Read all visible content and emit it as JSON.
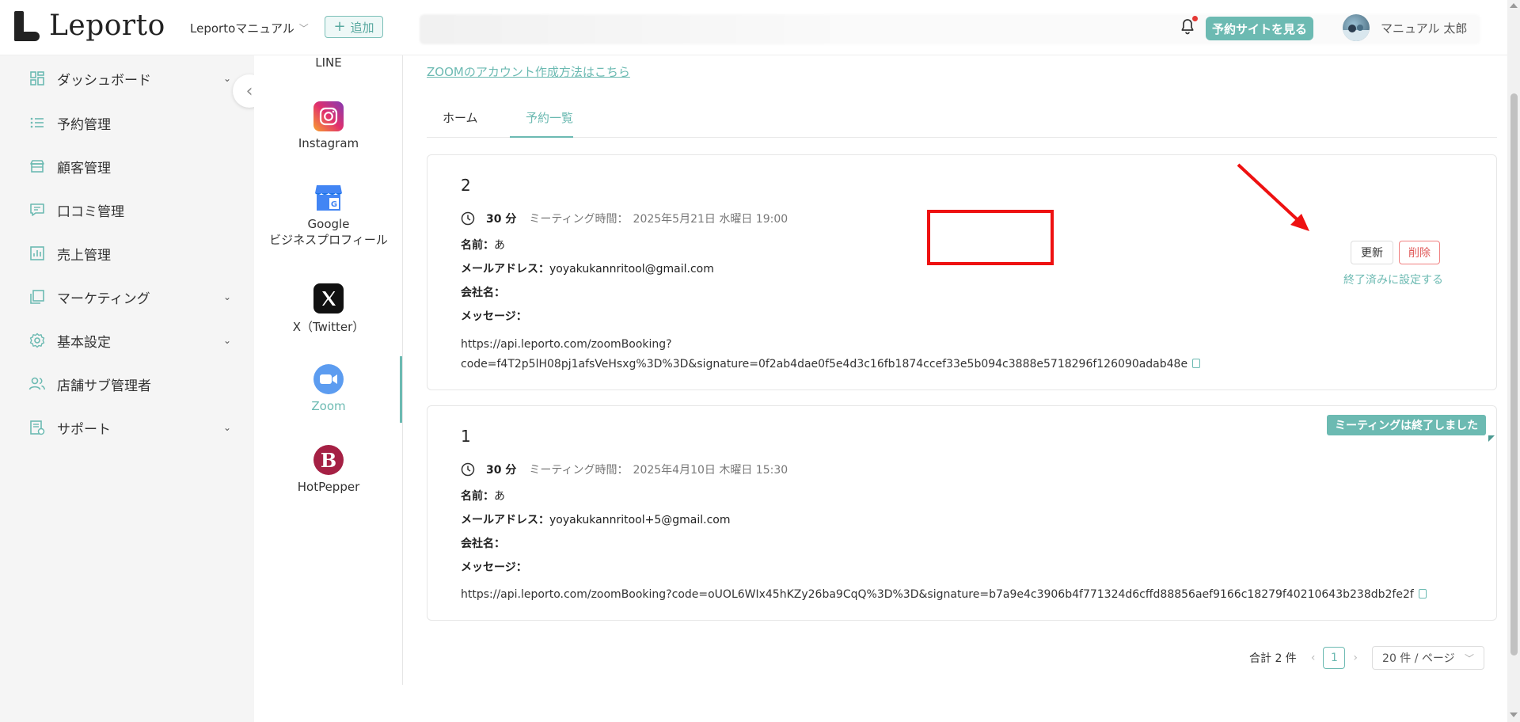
{
  "header": {
    "logo_text": "Leporto",
    "store_name": "Leportoマニュアル",
    "add_label": "追加",
    "view_site_label": "予約サイトを見る",
    "user_name": "マニュアル 太郎"
  },
  "sidebar": {
    "items": [
      {
        "label": "ダッシュボード",
        "icon": "dashboard-icon",
        "has_caret": true
      },
      {
        "label": "予約管理",
        "icon": "list-icon",
        "has_caret": false
      },
      {
        "label": "顧客管理",
        "icon": "store-icon",
        "has_caret": false
      },
      {
        "label": "口コミ管理",
        "icon": "comment-icon",
        "has_caret": false
      },
      {
        "label": "売上管理",
        "icon": "chart-icon",
        "has_caret": false
      },
      {
        "label": "マーケティング",
        "icon": "copy-icon",
        "has_caret": true
      },
      {
        "label": "基本設定",
        "icon": "gear-icon",
        "has_caret": true
      },
      {
        "label": "店舗サブ管理者",
        "icon": "users-icon",
        "has_caret": false
      },
      {
        "label": "サポート",
        "icon": "support-icon",
        "has_caret": true
      }
    ]
  },
  "integrations": {
    "items": [
      {
        "label": "LINE"
      },
      {
        "label": "Instagram"
      },
      {
        "label": "Google",
        "sub": "ビジネスプロフィール"
      },
      {
        "label": "X（Twitter）"
      },
      {
        "label": "Zoom"
      },
      {
        "label": "HotPepper"
      }
    ]
  },
  "main": {
    "zoom_link": "ZOOMのアカウント作成方法はこちら",
    "tabs": [
      {
        "label": "ホーム"
      },
      {
        "label": "予約一覧"
      }
    ],
    "bookings": [
      {
        "number": "2",
        "duration": "30 分",
        "time_label": "ミーティング時間：",
        "time_value": "2025年5月21日 水曜日 19:00",
        "name_label": "名前：",
        "name_value": "あ",
        "email_label": "メールアドレス：",
        "email_value": "yoyakukannritool@gmail.com",
        "company_label": "会社名：",
        "company_value": "",
        "message_label": "メッセージ：",
        "message_value": "",
        "url_line1": "https://api.leporto.com/zoomBooking?",
        "url_line2": "code=f4T2p5lH08pj1afsVeHsxg%3D%3D&signature=0f2ab4dae0f5e4d3c16fb1874ccef33e5b094c3888e5718296f126090adab48e",
        "update_label": "更新",
        "delete_label": "削除",
        "finish_label": "終了済みに設定する"
      },
      {
        "number": "1",
        "duration": "30 分",
        "time_label": "ミーティング時間：",
        "time_value": "2025年4月10日 木曜日 15:30",
        "name_label": "名前：",
        "name_value": "あ",
        "email_label": "メールアドレス：",
        "email_value": "yoyakukannritool+5@gmail.com",
        "company_label": "会社名：",
        "company_value": "",
        "message_label": "メッセージ：",
        "message_value": "",
        "url": "https://api.leporto.com/zoomBooking?code=oUOL6WIx45hKZy26ba9CqQ%3D%3D&signature=b7a9e4c3906b4f771324d6cffd88856aef9166c18279f40210643b238db2fe2f",
        "ended_badge": "ミーティングは終了しました"
      }
    ],
    "pagination": {
      "total_label": "合計 2 件",
      "current_page": "1",
      "page_size": "20 件 / ページ"
    }
  },
  "colors": {
    "accent": "#6cbab2",
    "danger": "#e05a5a",
    "highlight": "#ee1111"
  }
}
